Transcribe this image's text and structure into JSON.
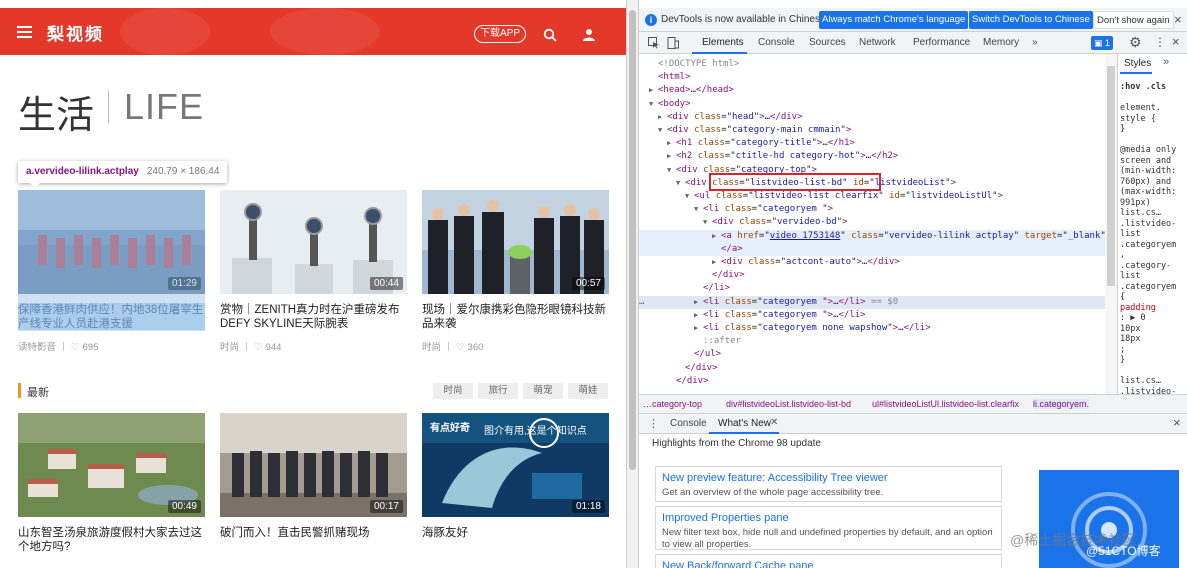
{
  "site": {
    "logo": "梨视频",
    "download_label": "下载APP",
    "icons": {
      "menu": "menu-icon",
      "search": "search-icon",
      "user": "user-icon"
    },
    "brand_color": "#e4392a"
  },
  "category": {
    "title": "生活",
    "title_en": "LIFE"
  },
  "tooltip": {
    "selector": "a.vervideo-lilink.actplay",
    "dimensions": "240.79 × 186.44"
  },
  "hot_cards": [
    {
      "title": "保障香港鲜肉供应！内地38位屠宰生产线专业人员赴港支援",
      "duration": "01:29",
      "source": "读特影音",
      "likes": "695"
    },
    {
      "title": "赏物｜ZENITH真力时在沪重磅发布DEFY SKYLINE天际腕表",
      "duration": "00:44",
      "source": "时尚",
      "likes": "944"
    },
    {
      "title": "现场｜爱尔康携彩色隐形眼镜科技新品来袭",
      "duration": "00:57",
      "source": "时尚",
      "likes": "360"
    }
  ],
  "latest": {
    "title": "最新",
    "tags": [
      "时尚",
      "旅行",
      "萌宠",
      "萌娃"
    ],
    "cards": [
      {
        "title": "山东智圣汤泉旅游度假村大家去过这个地方吗?",
        "duration": "00:49"
      },
      {
        "title": "破门而入！直击民警抓赌现场",
        "duration": "00:17"
      },
      {
        "title": "海豚友好",
        "duration": "01:18",
        "overlay_text_a": "有点好奇",
        "overlay_text_b": "图介有用,这是个知识点"
      }
    ]
  },
  "devtools": {
    "notice": {
      "text": "DevTools is now available in Chinese!",
      "btn_match": "Always match Chrome's language",
      "btn_switch": "Switch DevTools to Chinese",
      "btn_dont_show": "Don't show again"
    },
    "tabs": [
      "Elements",
      "Console",
      "Sources",
      "Network",
      "Performance",
      "Memory"
    ],
    "more_tabs": "»",
    "issues_count": "1",
    "dom_lines": [
      {
        "indent": 0,
        "tri": "",
        "html": "<span class='gray'>&lt;!DOCTYPE html&gt;</span>"
      },
      {
        "indent": 0,
        "tri": "",
        "html": "<span class='tag'>&lt;html&gt;</span>"
      },
      {
        "indent": 0,
        "tri": "▶",
        "html": "<span class='tag'>&lt;head&gt;</span>…<span class='tag'>&lt;/head&gt;</span>"
      },
      {
        "indent": 0,
        "tri": "▼",
        "html": "<span class='tag'>&lt;body&gt;</span>"
      },
      {
        "indent": 1,
        "tri": "▶",
        "html": "<span class='tag'>&lt;div</span> <span class='attr'>class</span>=\"<span class='val'>head</span>\"<span class='tag'>&gt;</span>…<span class='tag'>&lt;/div&gt;</span>"
      },
      {
        "indent": 1,
        "tri": "▼",
        "html": "<span class='tag'>&lt;div</span> <span class='attr'>class</span>=\"<span class='val'>category-main cmmain</span>\"<span class='tag'>&gt;</span>"
      },
      {
        "indent": 2,
        "tri": "▶",
        "html": "<span class='tag'>&lt;h1</span> <span class='attr'>class</span>=\"<span class='val'>category-title</span>\"<span class='tag'>&gt;</span>…<span class='tag'>&lt;/h1&gt;</span>"
      },
      {
        "indent": 2,
        "tri": "▶",
        "html": "<span class='tag'>&lt;h2</span> <span class='attr'>class</span>=\"<span class='val'>ctitle-hd category-hot</span>\"<span class='tag'>&gt;</span>…<span class='tag'>&lt;/h2&gt;</span>"
      },
      {
        "indent": 2,
        "tri": "▼",
        "html": "<span class='tag'>&lt;div</span> <span class='attr'>class</span>=\"<span class='val'>category-top</span>\"<span class='tag'>&gt;</span>"
      },
      {
        "indent": 3,
        "tri": "▼",
        "html": "<span class='tag'>&lt;div</span> <span class='attr'>class</span>=\"<span class='val'>listvideo-list-bd</span>\" <span class='attr'>id</span>=\"<span class='val'>listvideoList</span>\"<span class='tag'>&gt;</span>"
      },
      {
        "indent": 4,
        "tri": "▼",
        "html": "<span class='tag'>&lt;ul</span> <span class='attr'>class</span>=\"<span class='val'>listvideo-list clearfix</span>\" <span class='attr'>id</span>=\"<span class='val'>listvideoListUl</span>\"<span class='tag'>&gt;</span>"
      },
      {
        "indent": 5,
        "tri": "▼",
        "html": "<span class='tag'>&lt;li</span> <span class='attr'>class</span>=\"<span class='val'>categoryem </span>\"<span class='tag'>&gt;</span>"
      },
      {
        "indent": 6,
        "tri": "▼",
        "html": "<span class='tag'>&lt;div</span> <span class='attr'>class</span>=\"<span class='val'>vervideo-bd</span>\"<span class='tag'>&gt;</span>"
      },
      {
        "indent": 7,
        "tri": "▶",
        "html": "<span class='tag'>&lt;a</span> <span class='attr'>href</span>=\"<span class='link'>video_1753148</span>\" <span class='attr'>class</span>=\"<span class='val'>vervideo-lilink actplay</span>\" <span class='attr'>target</span>=\"<span class='val'>_blank</span>\"<span class='tag'>&gt;</span>…",
        "hover": true
      },
      {
        "indent": 7,
        "tri": "",
        "html": "<span class='tag'>&lt;/a&gt;</span>",
        "hover": true
      },
      {
        "indent": 7,
        "tri": "▶",
        "html": "<span class='tag'>&lt;div</span> <span class='attr'>class</span>=\"<span class='val'>actcont-auto</span>\"<span class='tag'>&gt;</span>…<span class='tag'>&lt;/div&gt;</span>"
      },
      {
        "indent": 6,
        "tri": "",
        "html": "<span class='tag'>&lt;/div&gt;</span>"
      },
      {
        "indent": 5,
        "tri": "",
        "html": "<span class='tag'>&lt;/li&gt;</span>"
      },
      {
        "indent": 5,
        "tri": "▶",
        "html": "<span class='tag'>&lt;li</span> <span class='attr'>class</span>=\"<span class='val'>categoryem </span>\"<span class='tag'>&gt;</span>…<span class='tag'>&lt;/li&gt;</span> <span class='gray'>== $0</span>",
        "selected": true
      },
      {
        "indent": 5,
        "tri": "▶",
        "html": "<span class='tag'>&lt;li</span> <span class='attr'>class</span>=\"<span class='val'>categoryem </span>\"<span class='tag'>&gt;</span>…<span class='tag'>&lt;/li&gt;</span>"
      },
      {
        "indent": 5,
        "tri": "▶",
        "html": "<span class='tag'>&lt;li</span> <span class='attr'>class</span>=\"<span class='val'>categoryem none wapshow</span>\"<span class='tag'>&gt;</span>…<span class='tag'>&lt;/li&gt;</span>"
      },
      {
        "indent": 5,
        "tri": "",
        "html": "<span class='gray'>::after</span>"
      },
      {
        "indent": 4,
        "tri": "",
        "html": "<span class='tag'>&lt;/ul&gt;</span>"
      },
      {
        "indent": 3,
        "tri": "",
        "html": "<span class='tag'>&lt;/div&gt;</span>"
      },
      {
        "indent": 2,
        "tri": "",
        "html": "<span class='tag'>&lt;/div&gt;</span>"
      }
    ],
    "styles": {
      "tab": "Styles",
      "lines": [
        ":hov .cls",
        "",
        "element.",
        "style {",
        "}",
        "",
        "@media only",
        "screen and",
        "(min-width:",
        "760px) and",
        "(max-width:",
        "991px)",
        "  list.cs…",
        ".listvideo-",
        "list",
        ".categoryem",
        ",",
        ".category-",
        "list",
        ".categoryem",
        "{",
        "  padding",
        "    : ▶ 0",
        "    10px",
        "    18px",
        "    ;",
        "}",
        "",
        "  list.cs…",
        ".listvideo-",
        "list"
      ]
    },
    "breadcrumb": [
      "…category-top",
      "div#listvideoList.listvideo-list-bd",
      "ul#listvideoListUl.listvideo-list.clearfix",
      "li.categoryem."
    ],
    "drawer": {
      "tabs": [
        "Console",
        "What's New"
      ],
      "highlights": "Highlights from the Chrome 98 update",
      "cards": [
        {
          "head": "New preview feature: Accessibility Tree viewer",
          "body": "Get an overview of the whole page accessibility tree."
        },
        {
          "head": "Improved Properties pane",
          "body": "New filter text box, hide null and undefined properties by default, and an option to view all properties."
        },
        {
          "head": "New Back/forward Cache pane",
          "body": ""
        }
      ]
    }
  },
  "watermark": {
    "text": "@稀土掘金技术社区",
    "text2": "@51CTO博客"
  }
}
